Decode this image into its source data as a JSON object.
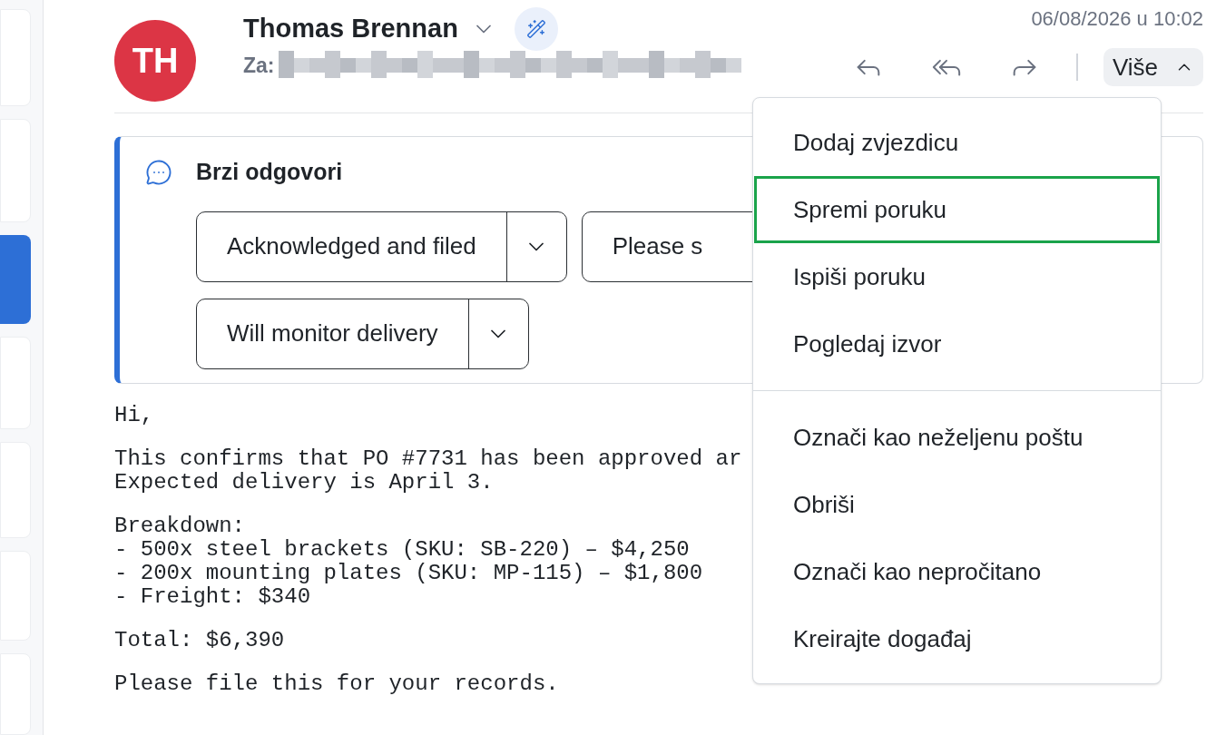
{
  "sender": {
    "initials": "TH",
    "name": "Thomas Brennan",
    "to_label": "Za:"
  },
  "date": "06/08/2026 u 10:02",
  "more_button": {
    "label": "Više",
    "expanded": true
  },
  "quick_replies": {
    "title": "Brzi odgovori",
    "replies": [
      {
        "label": "Acknowledged and filed",
        "has_dropdown": true
      },
      {
        "label": "Please s",
        "has_dropdown": false
      },
      {
        "label": "Will monitor delivery",
        "has_dropdown": true
      }
    ]
  },
  "body_paragraphs": [
    [
      "Hi,"
    ],
    [
      "This confirms that PO #7731 has been approved ar",
      "Expected delivery is April 3."
    ],
    [
      "Breakdown:",
      "- 500x steel brackets (SKU: SB-220) – $4,250",
      "- 200x mounting plates (SKU: MP-115) – $1,800",
      "- Freight: $340"
    ],
    [
      "Total: $6,390"
    ],
    [
      "Please file this for your records."
    ]
  ],
  "menu": {
    "groups": [
      [
        {
          "label": "Dodaj zvjezdicu",
          "selected": false
        },
        {
          "label": "Spremi poruku",
          "selected": true
        },
        {
          "label": "Ispiši poruku",
          "selected": false
        },
        {
          "label": "Pogledaj izvor",
          "selected": false
        }
      ],
      [
        {
          "label": "Označi kao neželjenu poštu",
          "selected": false
        },
        {
          "label": "Obriši",
          "selected": false
        },
        {
          "label": "Označi kao nepročitano",
          "selected": false
        },
        {
          "label": "Kreirajte događaj",
          "selected": false
        }
      ]
    ]
  }
}
